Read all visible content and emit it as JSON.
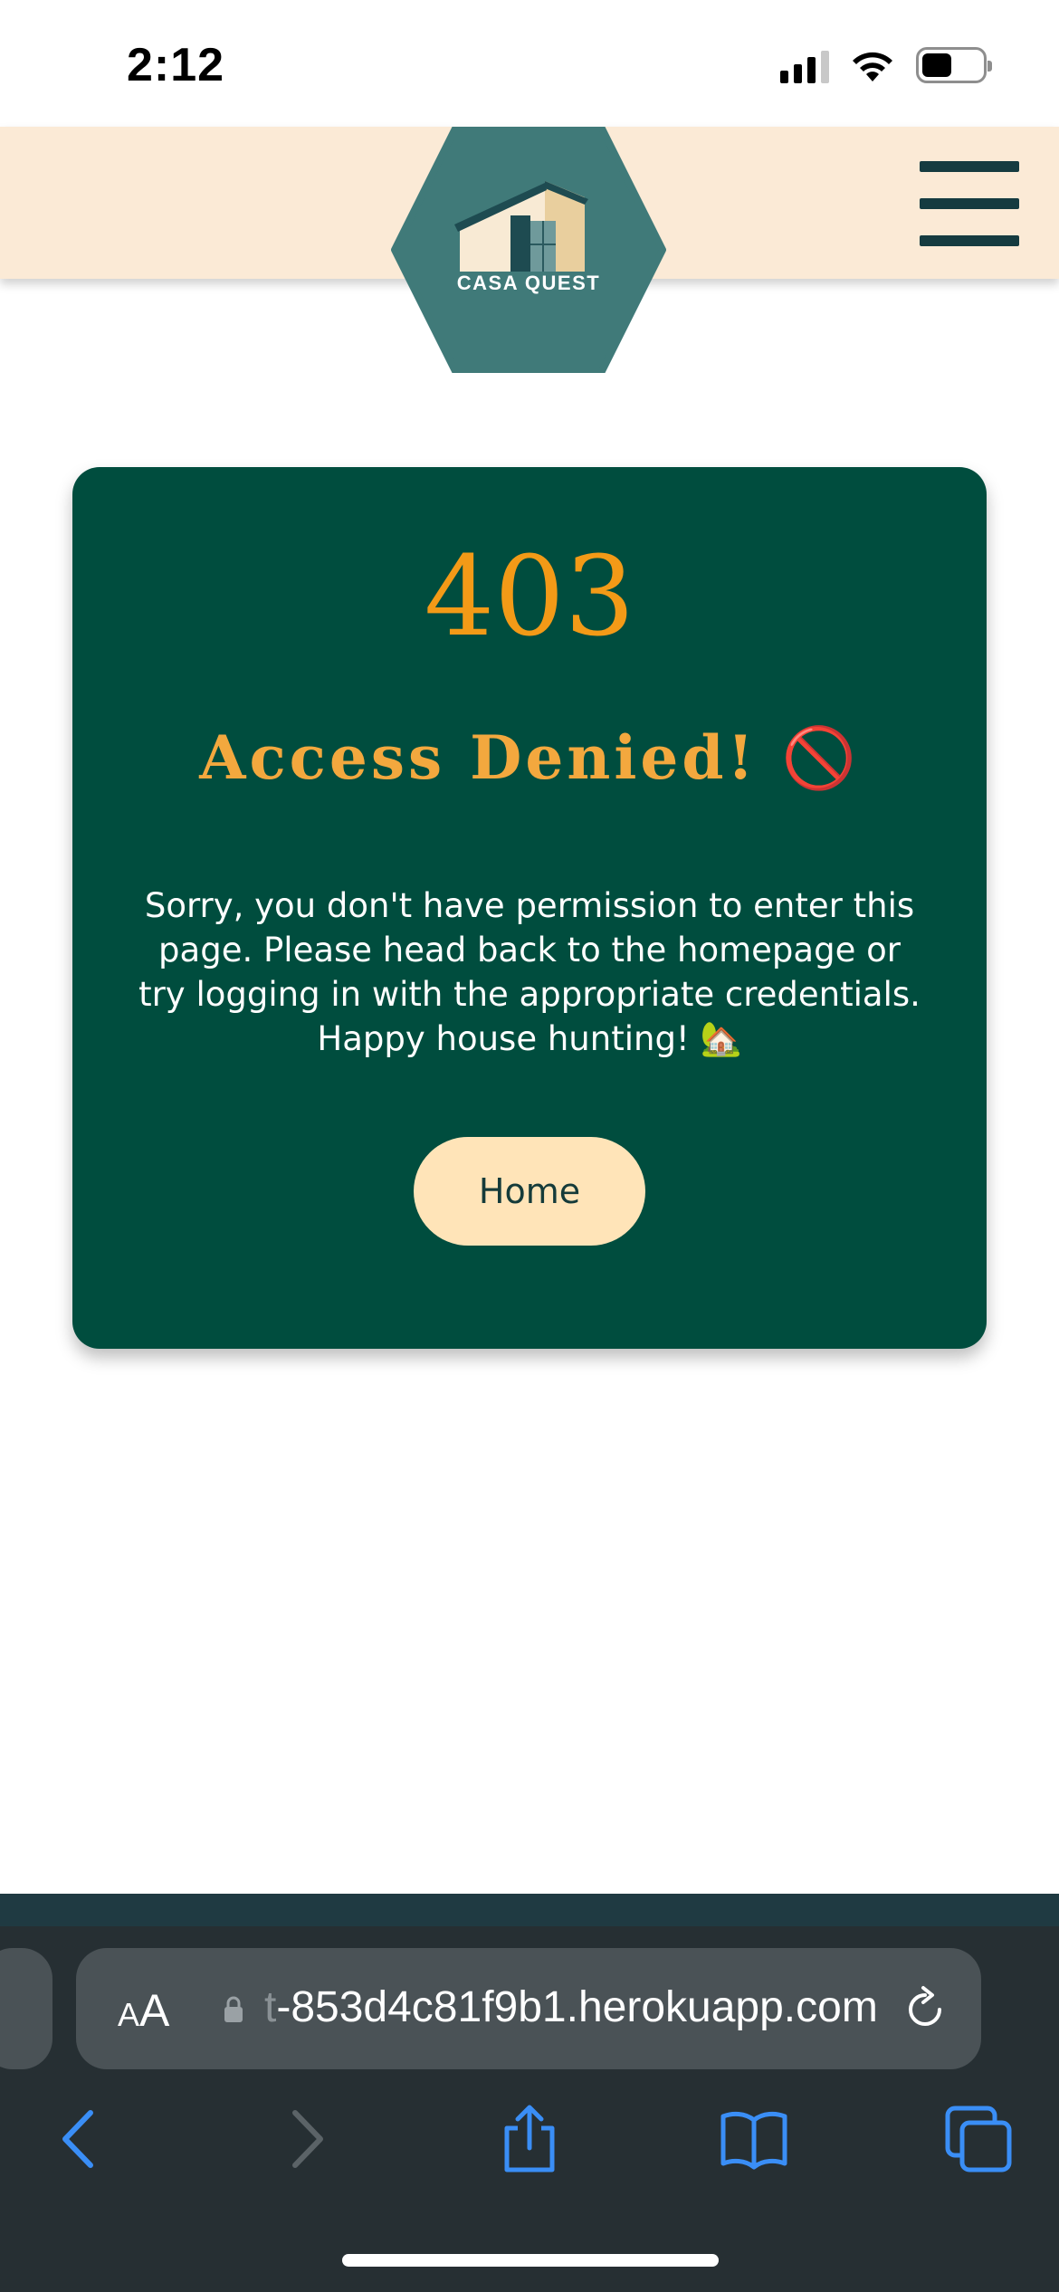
{
  "status_bar": {
    "time": "2:12"
  },
  "header": {
    "logo_text": "CASA QUEST",
    "menu_icon": "hamburger-menu-icon"
  },
  "error_card": {
    "code": "403",
    "title": "Access Denied! 🚫",
    "message": "Sorry, you don't have permission to enter this page. Please head back to the homepage or try logging in with the appropriate credentials. Happy house hunting! 🏡",
    "home_button_label": "Home"
  },
  "browser": {
    "text_size_small": "A",
    "text_size_large": "A",
    "url_faded_prefix": "t",
    "url": "-853d4c81f9b1.herokuapp.com",
    "toolbar_icons": [
      "back-icon",
      "forward-icon",
      "share-icon",
      "bookmarks-icon",
      "tabs-icon"
    ]
  },
  "colors": {
    "header_bg": "#fbead6",
    "logo_hex": "#407a79",
    "card_bg": "#004d3e",
    "accent_orange": "#f39a17",
    "button_bg": "#ffe4b8",
    "browser_chrome": "#262f33",
    "ios_blue": "#3a8ef6"
  }
}
